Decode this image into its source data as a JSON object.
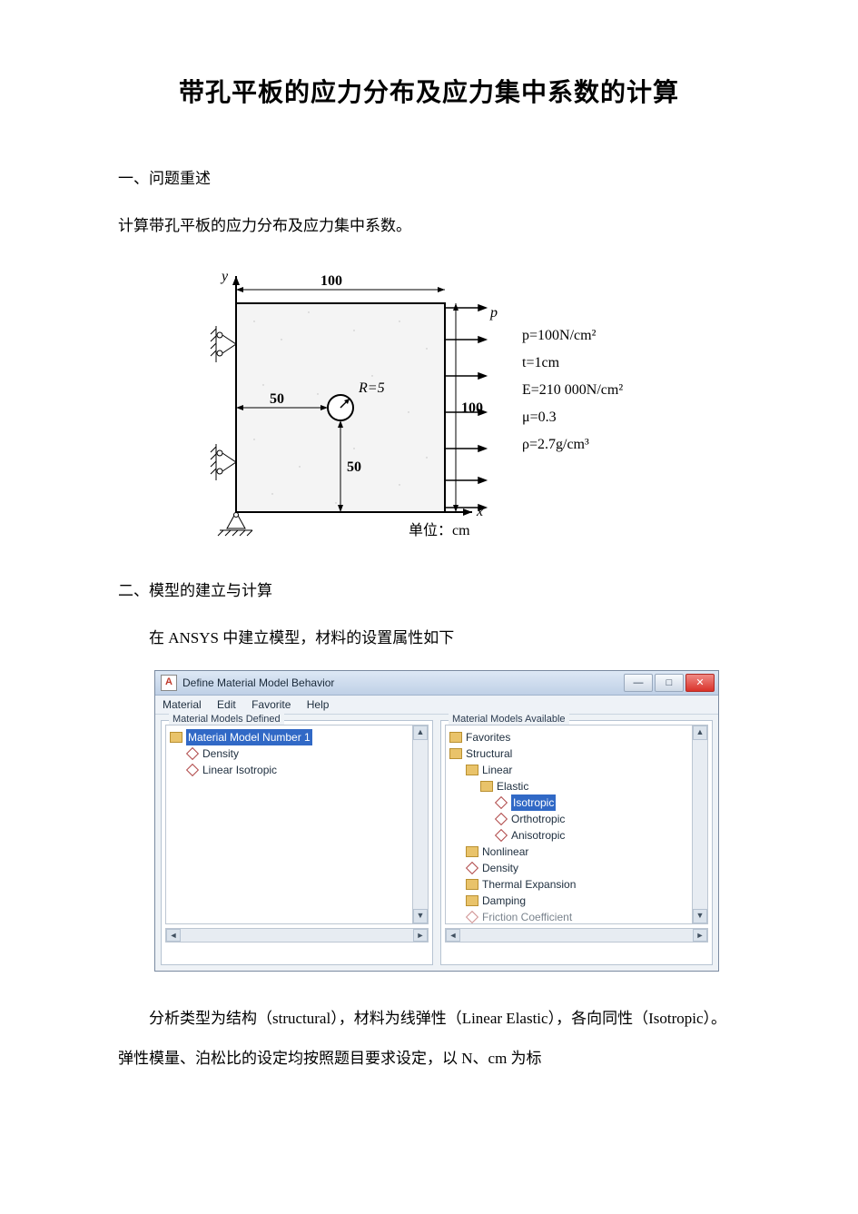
{
  "title": "带孔平板的应力分布及应力集中系数的计算",
  "section1": "一、问题重述",
  "p1": "计算带孔平板的应力分布及应力集中系数。",
  "section2": "二、模型的建立与计算",
  "p2": "在 ANSYS 中建立模型，材料的设置属性如下",
  "p3": "分析类型为结构（structural），材料为线弹性（Linear Elastic），各向同性（Isotropic）。弹性模量、泊松比的设定均按照题目要求设定，以 N、cm 为标",
  "diagram": {
    "y_axis": "y",
    "x_axis": "x",
    "top_dim": "100",
    "right_dim": "100",
    "left_dim": "50",
    "bottom_dim": "50",
    "radius_label": "R=5",
    "load_label": "p",
    "params": {
      "p": "p=100N/cm²",
      "t": "t=1cm",
      "E": "E=210 000N/cm²",
      "mu": "μ=0.3",
      "rho": "ρ=2.7g/cm³"
    },
    "unit_label": "单位：cm"
  },
  "dialog": {
    "title": "Define Material Model Behavior",
    "menu": {
      "m1": "Material",
      "m2": "Edit",
      "m3": "Favorite",
      "m4": "Help"
    },
    "left": {
      "title": "Material Models Defined",
      "root": "Material Model Number 1",
      "c1": "Density",
      "c2": "Linear Isotropic"
    },
    "right": {
      "title": "Material Models Available",
      "favorites": "Favorites",
      "structural": "Structural",
      "linear": "Linear",
      "elastic": "Elastic",
      "isotropic": "Isotropic",
      "orthotropic": "Orthotropic",
      "anisotropic": "Anisotropic",
      "nonlinear": "Nonlinear",
      "density": "Density",
      "thermal": "Thermal Expansion",
      "damping": "Damping",
      "friction": "Friction Coefficient"
    },
    "winbtns": {
      "min": "—",
      "max": "□",
      "close": "✕"
    }
  }
}
